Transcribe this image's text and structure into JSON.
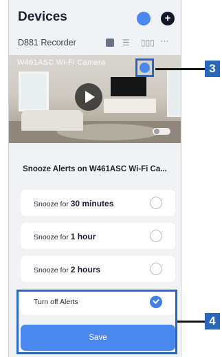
{
  "header": {
    "title": "Devices",
    "add_glyph": "+"
  },
  "device": {
    "name": "D881 Recorder",
    "icons": [
      "playback-icon",
      "list-icon",
      "grid-icon",
      "more-icon"
    ]
  },
  "camera": {
    "name": "W461ASC Wi-Fi Camera"
  },
  "sheet": {
    "title": "Snooze Alerts on W461ASC Wi-Fi Ca...",
    "options": [
      {
        "prefix": "Snooze for ",
        "bold": "30 minutes",
        "selected": false
      },
      {
        "prefix": "Snooze for ",
        "bold": "1 hour",
        "selected": false
      },
      {
        "prefix": "Snooze for ",
        "bold": "2 hours",
        "selected": false
      },
      {
        "prefix": "Turn off Alerts",
        "bold": "",
        "selected": true
      }
    ],
    "save_label": "Save"
  },
  "callouts": {
    "bell": "3",
    "alerts": "4"
  },
  "colors": {
    "accent": "#4a88ee",
    "callout": "#2a66b9"
  }
}
